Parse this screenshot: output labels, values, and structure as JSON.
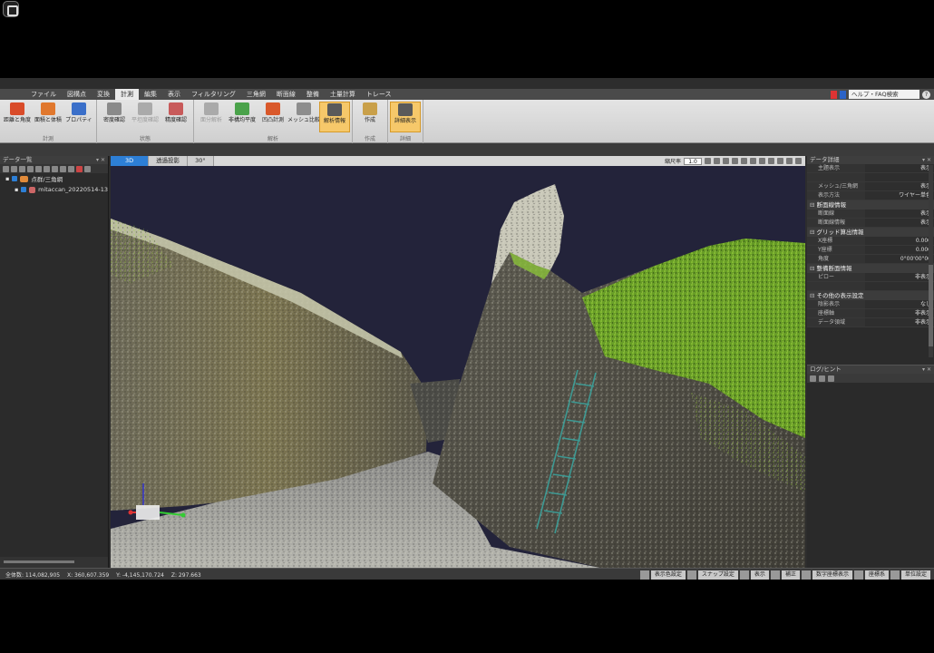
{
  "menu": {
    "tabs": [
      "ファイル",
      "図構点",
      "変換",
      "計測",
      "編集",
      "表示",
      "フィルタリング",
      "三角網",
      "断面線",
      "整備",
      "土量計算",
      "トレース"
    ],
    "active_index": 3,
    "help_search": "ヘルプ・FAQ検索",
    "help_icon": "?"
  },
  "ribbon": {
    "groups": [
      {
        "label": "計測",
        "buttons": [
          {
            "label": "距離と角度",
            "icon": "distance-angle-icon",
            "color": "#d94c2a",
            "state": "normal"
          },
          {
            "label": "面積と体積",
            "icon": "area-volume-icon",
            "color": "#e0782e",
            "state": "normal"
          },
          {
            "label": "プロパティ",
            "icon": "property-icon",
            "color": "#3a6fc9",
            "state": "normal"
          }
        ]
      },
      {
        "label": "状態",
        "buttons": [
          {
            "label": "密度確認",
            "icon": "density-icon",
            "color": "#8a8a8a",
            "state": "normal"
          },
          {
            "label": "平坦度確認",
            "icon": "flatness-icon",
            "color": "#aaaaaa",
            "state": "disabled"
          },
          {
            "label": "精度確認",
            "icon": "accuracy-icon",
            "color": "#c85a5a",
            "state": "normal"
          }
        ]
      },
      {
        "label": "解析",
        "buttons": [
          {
            "label": "面分解析",
            "icon": "surface-analysis-icon",
            "color": "#aaaaaa",
            "state": "disabled"
          },
          {
            "label": "非構均平度",
            "icon": "levelness-icon",
            "color": "#4aa24a",
            "state": "normal"
          },
          {
            "label": "凹凸計測",
            "icon": "unevenness-icon",
            "color": "#d9582a",
            "state": "normal"
          },
          {
            "label": "メッシュ比較",
            "icon": "mesh-compare-icon",
            "color": "#8d8d8d",
            "state": "normal"
          },
          {
            "label": "解析情報",
            "icon": "analysis-info-icon",
            "color": "#5a5a5a",
            "state": "highlight"
          }
        ]
      },
      {
        "label": "作成",
        "buttons": [
          {
            "label": "作成",
            "icon": "create-icon",
            "color": "#c9a04a",
            "state": "normal"
          }
        ]
      },
      {
        "label": "詳細",
        "buttons": [
          {
            "label": "詳細表示",
            "icon": "detail-view-icon",
            "color": "#5a5a5a",
            "state": "highlight"
          }
        ]
      }
    ]
  },
  "left_panel": {
    "title": "データ一覧",
    "tree": [
      {
        "label": "点群/三角網",
        "indent": 0,
        "kind": "folder"
      },
      {
        "label": "mitaccan_20220514-13",
        "indent": 1,
        "kind": "pointcloud"
      }
    ]
  },
  "viewport": {
    "tabs": [
      "3D",
      "透過投影",
      "30°"
    ],
    "active_tab": 0,
    "zoom_label": "縮尺率",
    "zoom_value": "1.0"
  },
  "right_panel": {
    "title": "データ詳細",
    "rows": [
      {
        "type": "row",
        "key": "主題表示",
        "value": "表示"
      },
      {
        "type": "row",
        "key": "",
        "value": ""
      },
      {
        "type": "row",
        "key": "メッシュ/三角網",
        "value": "表示"
      },
      {
        "type": "row",
        "key": "表示方法",
        "value": "ワイヤー単色"
      },
      {
        "type": "section",
        "key": "断面線情報"
      },
      {
        "type": "row",
        "key": "断面線",
        "value": "表示"
      },
      {
        "type": "row",
        "key": "断面線情報",
        "value": "表示"
      },
      {
        "type": "section",
        "key": "グリッド算出情報"
      },
      {
        "type": "row",
        "key": "X座標",
        "value": "0.000"
      },
      {
        "type": "row",
        "key": "Y座標",
        "value": "0.000"
      },
      {
        "type": "row",
        "key": "角度",
        "value": "0°00'00\"00"
      },
      {
        "type": "section",
        "key": "整備断面情報"
      },
      {
        "type": "row",
        "key": "ピロー",
        "value": "非表示"
      },
      {
        "type": "row",
        "key": "",
        "value": ""
      },
      {
        "type": "section",
        "key": "その他の表示設定"
      },
      {
        "type": "row",
        "key": "陰影表示",
        "value": "なし"
      },
      {
        "type": "row",
        "key": "座標軸",
        "value": "非表示"
      },
      {
        "type": "row",
        "key": "データ領域",
        "value": "非表示"
      }
    ],
    "log_title": "ログ/ヒント"
  },
  "status": {
    "text": "全体数: 114,082,905 　X: 360,607.359 　Y: -4,145,170.724 　Z: 297.663",
    "buttons": [
      "表示色設定",
      "スナップ設定",
      "表示",
      "補正",
      "数字座標表示",
      "座標系",
      "単位設定"
    ]
  },
  "colors": {
    "ribbon_highlight": "#f6c86a",
    "active_tab": "#2d7fd6",
    "viewport_bg": "#23233a",
    "moss": "#6aa524"
  }
}
